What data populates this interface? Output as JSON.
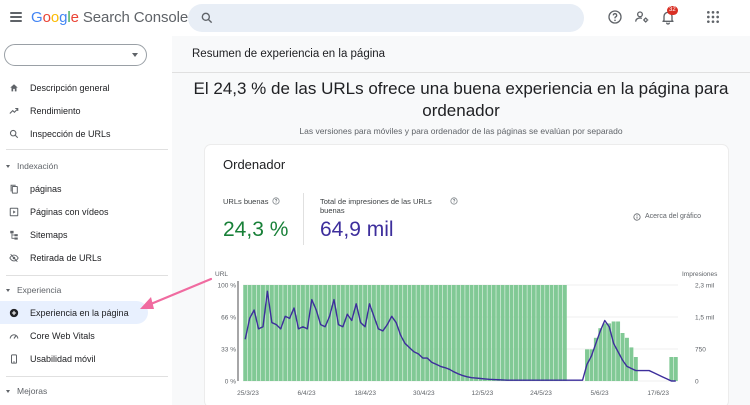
{
  "app": {
    "google": [
      "G",
      "o",
      "o",
      "g",
      "l",
      "e"
    ],
    "product": "Search Console",
    "notification_count": "32"
  },
  "sidebar": {
    "items_top": [
      {
        "label": "Descripción general",
        "icon": "home-icon"
      },
      {
        "label": "Rendimiento",
        "icon": "trending-up-icon"
      },
      {
        "label": "Inspección de URLs",
        "icon": "search-icon"
      }
    ],
    "section_indexacion": "Indexación",
    "items_indexacion": [
      {
        "label": "páginas",
        "icon": "file-copy-icon"
      },
      {
        "label": "Páginas con vídeos",
        "icon": "video-page-icon"
      },
      {
        "label": "Sitemaps",
        "icon": "sitemap-icon"
      },
      {
        "label": "Retirada de URLs",
        "icon": "visibility-off-icon"
      }
    ],
    "section_experiencia": "Experiencia",
    "items_experiencia": [
      {
        "label": "Experiencia en la página",
        "icon": "add-circle-icon"
      },
      {
        "label": "Core Web Vitals",
        "icon": "speed-icon"
      },
      {
        "label": "Usabilidad móvil",
        "icon": "smartphone-icon"
      }
    ],
    "section_mejoras": "Mejoras"
  },
  "main": {
    "page_title": "Resumen de experiencia en la página",
    "headline_1": "El 24,3 % de las URLs ofrece una buena experiencia en la página para",
    "headline_2": "ordenador",
    "subline": "Las versiones para móviles y para ordenador de las páginas se evalúan por separado",
    "card": {
      "title": "Ordenador",
      "metric1_label": "URLs buenas",
      "metric1_value": "24,3 %",
      "metric2_label_1": "Total de impresiones de las URLs",
      "metric2_label_2": "buenas",
      "metric2_value": "64,9 mil",
      "about_chart": "Acerca del gráfico"
    }
  },
  "colors": {
    "bar": "#81c995",
    "line": "#3d2e9c",
    "good": "#188038",
    "arrow": "#f06ba0",
    "active": "#e8f0fe"
  },
  "chart_data": {
    "type": "bar",
    "left_axis_label": "URL",
    "right_axis_label": "Impresiones",
    "left_ticks": [
      "100 %",
      "66 %",
      "33 %",
      "0 %"
    ],
    "right_ticks": [
      "2,3 mil",
      "1,5 mil",
      "750",
      "0"
    ],
    "x_ticks": [
      "25/3/23",
      "6/4/23",
      "18/4/23",
      "30/4/23",
      "12/5/23",
      "24/5/23",
      "5/6/23",
      "17/6/23"
    ],
    "ylim_left": [
      0,
      100
    ],
    "ylim_right": [
      0,
      2300
    ],
    "series": [
      {
        "name": "URL",
        "values": [
          100,
          100,
          100,
          100,
          100,
          100,
          100,
          100,
          100,
          100,
          100,
          100,
          100,
          100,
          100,
          100,
          100,
          100,
          100,
          100,
          100,
          100,
          100,
          100,
          100,
          100,
          100,
          100,
          100,
          100,
          100,
          100,
          100,
          100,
          100,
          100,
          100,
          100,
          100,
          100,
          100,
          100,
          100,
          100,
          100,
          100,
          100,
          100,
          100,
          100,
          100,
          100,
          100,
          100,
          100,
          100,
          100,
          100,
          100,
          100,
          100,
          100,
          100,
          100,
          100,
          100,
          100,
          100,
          100,
          100,
          100,
          100,
          100,
          0,
          0,
          0,
          0,
          33,
          33,
          45,
          55,
          60,
          60,
          62,
          62,
          50,
          45,
          35,
          25,
          0,
          0,
          0,
          0,
          0,
          0,
          0,
          25,
          25
        ]
      },
      {
        "name": "Impresiones",
        "values": [
          1000,
          1500,
          1700,
          1250,
          1300,
          2150,
          1400,
          1350,
          1250,
          1550,
          1500,
          1750,
          1250,
          1300,
          1250,
          1950,
          1700,
          1350,
          1300,
          1550,
          1950,
          1350,
          1300,
          1600,
          1450,
          1850,
          1400,
          1300,
          1850,
          1550,
          1250,
          1200,
          1350,
          1550,
          1400,
          1100,
          900,
          800,
          700,
          650,
          550,
          550,
          450,
          400,
          350,
          320,
          280,
          220,
          170,
          130,
          100,
          80,
          70,
          60,
          50,
          40,
          35,
          30,
          25,
          20,
          20,
          20,
          20,
          20,
          20,
          20,
          20,
          20,
          20,
          20,
          20,
          20,
          20,
          20,
          20,
          20,
          20,
          400,
          600,
          900,
          1200,
          1450,
          1300,
          900,
          700,
          500,
          350,
          300,
          250,
          250,
          250,
          250,
          200,
          150,
          100,
          50,
          0,
          0
        ]
      }
    ]
  }
}
